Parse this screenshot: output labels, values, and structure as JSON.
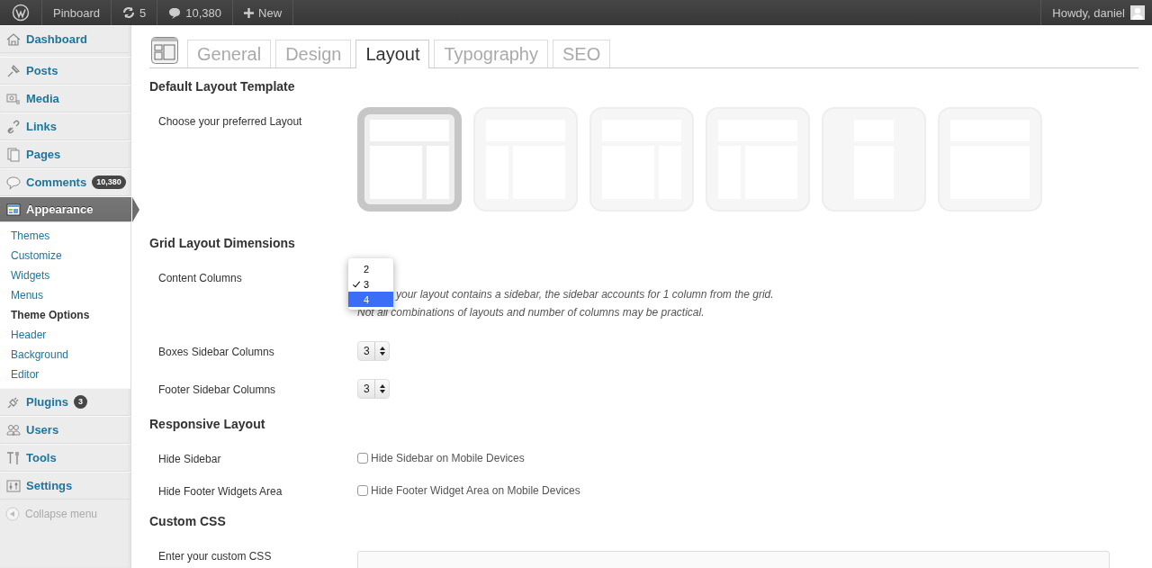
{
  "admin_bar": {
    "site": "Pinboard",
    "updates": "5",
    "comments": "10,380",
    "new": "New",
    "greeting": "Howdy, daniel"
  },
  "menu": [
    {
      "label": "Dashboard",
      "selected": false
    },
    {
      "label": "Posts",
      "selected": false
    },
    {
      "label": "Media",
      "selected": false
    },
    {
      "label": "Links",
      "selected": false
    },
    {
      "label": "Pages",
      "selected": false
    },
    {
      "label": "Comments",
      "selected": false,
      "badge": "10,380"
    },
    {
      "label": "Appearance",
      "selected": true,
      "children": [
        {
          "label": "Themes",
          "selected": false
        },
        {
          "label": "Customize",
          "selected": false
        },
        {
          "label": "Widgets",
          "selected": false
        },
        {
          "label": "Menus",
          "selected": false
        },
        {
          "label": "Theme Options",
          "selected": true
        },
        {
          "label": "Header",
          "selected": false
        },
        {
          "label": "Background",
          "selected": false
        },
        {
          "label": "Editor",
          "selected": false
        }
      ]
    },
    {
      "label": "Plugins",
      "selected": false,
      "badge": "3"
    },
    {
      "label": "Users",
      "selected": false
    },
    {
      "label": "Tools",
      "selected": false
    },
    {
      "label": "Settings",
      "selected": false
    }
  ],
  "collapse": "Collapse menu",
  "tabs": [
    {
      "label": "General",
      "selected": false
    },
    {
      "label": "Design",
      "selected": false
    },
    {
      "label": "Layout",
      "selected": true
    },
    {
      "label": "Typography",
      "selected": false
    },
    {
      "label": "SEO",
      "selected": false
    }
  ],
  "sections": [
    {
      "title": "Default Layout Template",
      "rows": [
        {
          "kind": "layouts",
          "label": "Choose your preferred Layout",
          "layouts": [
            {
              "kind": "main-right",
              "selected": true
            },
            {
              "kind": "left-main",
              "selected": false
            },
            {
              "kind": "main-right",
              "selected": false
            },
            {
              "kind": "left-main",
              "selected": false
            },
            {
              "kind": "narrow",
              "selected": false
            },
            {
              "kind": "full",
              "selected": false
            }
          ]
        }
      ]
    },
    {
      "title": "Grid Layout Dimensions",
      "rows": [
        {
          "kind": "open-select",
          "label": "Content Columns",
          "options": [
            {
              "label": "2",
              "selected": false,
              "highlighted": false
            },
            {
              "label": "3",
              "selected": true,
              "highlighted": false
            },
            {
              "label": "4",
              "selected": false,
              "highlighted": true
            }
          ],
          "notes": [
            "your layout contains a sidebar, the sidebar accounts for 1 column from the grid.",
            "Not all combinations of layouts and number of columns may be practical."
          ]
        },
        {
          "kind": "select",
          "label": "Boxes Sidebar Columns",
          "value": "3"
        },
        {
          "kind": "select",
          "label": "Footer Sidebar Columns",
          "value": "3"
        }
      ]
    },
    {
      "title": "Responsive Layout",
      "rows": [
        {
          "kind": "checkbox",
          "label": "Hide Sidebar",
          "text": "Hide Sidebar on Mobile Devices",
          "checked": false
        },
        {
          "kind": "checkbox",
          "label": "Hide Footer Widgets Area",
          "text": "Hide Footer Widget Area on Mobile Devices",
          "checked": false
        }
      ]
    },
    {
      "title": "Custom CSS",
      "rows": [
        {
          "kind": "textarea",
          "label": "Enter your custom CSS"
        }
      ]
    }
  ]
}
